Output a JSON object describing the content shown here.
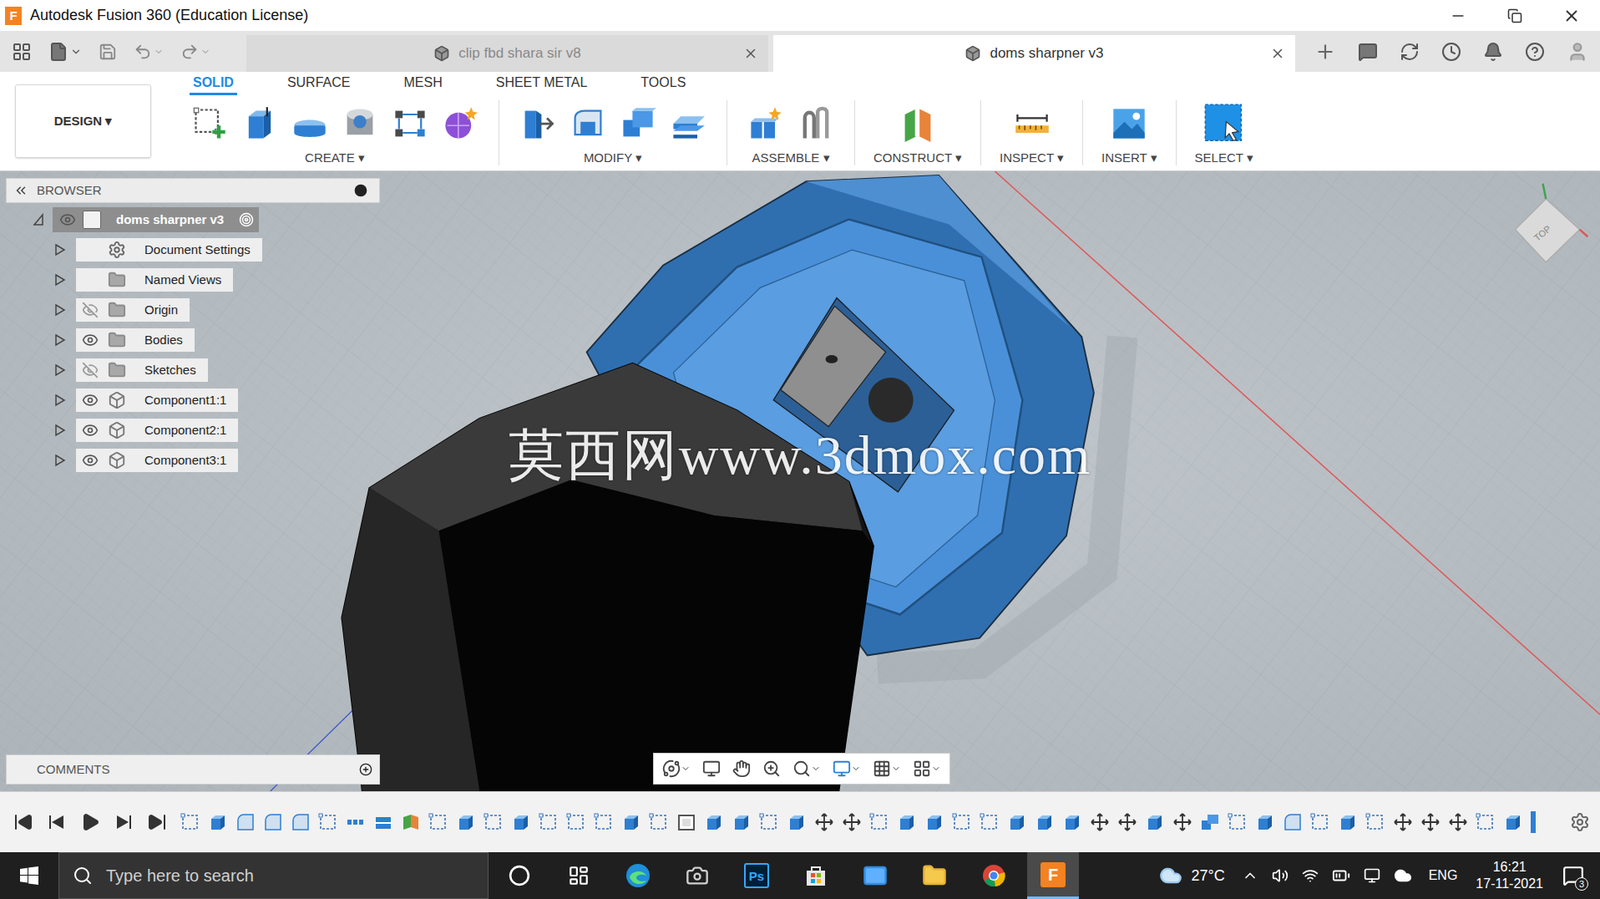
{
  "window": {
    "title": "Autodesk Fusion 360 (Education License)",
    "logo": "F"
  },
  "document_tabs": [
    {
      "label": "clip fbd shara sir v8",
      "selected": false
    },
    {
      "label": "doms sharpner v3",
      "selected": true
    }
  ],
  "workspace": {
    "label": "DESIGN ▾"
  },
  "ribbon_tabs": [
    {
      "label": "SOLID",
      "selected": true
    },
    {
      "label": "SURFACE",
      "selected": false
    },
    {
      "label": "MESH",
      "selected": false
    },
    {
      "label": "SHEET METAL",
      "selected": false
    },
    {
      "label": "TOOLS",
      "selected": false
    }
  ],
  "tool_groups": [
    {
      "label": "CREATE ▾",
      "tools": [
        "sketch",
        "extrude",
        "revolve",
        "hole",
        "pattern",
        "form"
      ]
    },
    {
      "label": "MODIFY ▾",
      "tools": [
        "presspull",
        "fillet",
        "combine",
        "offset"
      ]
    },
    {
      "label": "ASSEMBLE ▾",
      "tools": [
        "newcomponent",
        "joint"
      ]
    },
    {
      "label": "CONSTRUCT ▾",
      "tools": [
        "plane"
      ]
    },
    {
      "label": "INSPECT ▾",
      "tools": [
        "measure"
      ]
    },
    {
      "label": "INSERT ▾",
      "tools": [
        "canvas"
      ]
    },
    {
      "label": "SELECT ▾",
      "tools": [
        "select"
      ]
    }
  ],
  "browser": {
    "title": "BROWSER",
    "items": [
      {
        "label": "doms sharpner v3",
        "kind": "root",
        "visible": true,
        "expanded": true
      },
      {
        "label": "Document Settings",
        "kind": "settings",
        "expanded": false
      },
      {
        "label": "Named Views",
        "kind": "views",
        "expanded": false
      },
      {
        "label": "Origin",
        "kind": "folder",
        "visible": false,
        "expanded": false
      },
      {
        "label": "Bodies",
        "kind": "folder",
        "visible": true,
        "expanded": false
      },
      {
        "label": "Sketches",
        "kind": "folder",
        "visible": false,
        "expanded": false
      },
      {
        "label": "Component1:1",
        "kind": "component",
        "visible": true,
        "expanded": false
      },
      {
        "label": "Component2:1",
        "kind": "component",
        "visible": true,
        "expanded": false
      },
      {
        "label": "Component3:1",
        "kind": "component",
        "visible": true,
        "expanded": false
      }
    ]
  },
  "comments": {
    "title": "COMMENTS"
  },
  "watermark": "莫西网www.3dmox.com",
  "viewcube": {
    "label": "TOP"
  },
  "timeline": {
    "features": [
      "sketch",
      "extrude",
      "fillet",
      "fillet",
      "fillet",
      "sketch",
      "pattern",
      "split",
      "plane",
      "sketch",
      "extrude",
      "sketch",
      "extrude",
      "sketch",
      "sketch",
      "sketch",
      "extrude",
      "sketch",
      "shell",
      "extrude",
      "extrude",
      "sketch",
      "extrude",
      "move",
      "move",
      "sketch",
      "extrude",
      "extrude",
      "sketch",
      "sketch",
      "extrude",
      "extrude",
      "extrude",
      "move",
      "move",
      "extrude",
      "move",
      "combine",
      "sketch",
      "extrude",
      "fillet",
      "sketch",
      "extrude",
      "sketch",
      "move",
      "move",
      "move",
      "sketch",
      "extrude"
    ]
  },
  "taskbar": {
    "search_placeholder": "Type here to search",
    "apps": [
      {
        "kind": "cortana",
        "selected": false
      },
      {
        "kind": "taskview",
        "selected": false
      },
      {
        "kind": "edge",
        "selected": false
      },
      {
        "kind": "camera",
        "selected": false
      },
      {
        "kind": "photoshop",
        "label": "Ps",
        "selected": false
      },
      {
        "kind": "store",
        "selected": false
      },
      {
        "kind": "mail",
        "selected": false
      },
      {
        "kind": "explorer",
        "selected": false
      },
      {
        "kind": "chrome",
        "selected": false
      },
      {
        "kind": "fusion",
        "label": "F",
        "selected": true
      }
    ],
    "weather": "27°C",
    "language": "ENG",
    "time": "16:21",
    "date": "17-11-2021",
    "notifications": "3"
  }
}
